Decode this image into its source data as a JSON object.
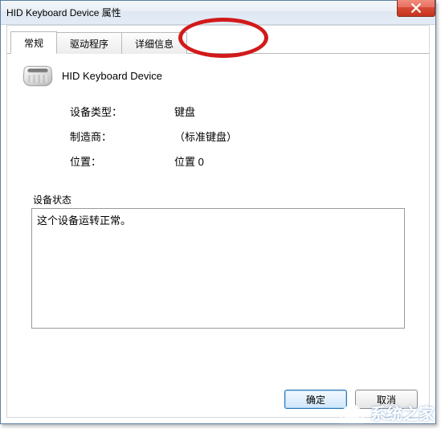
{
  "window": {
    "title": "HID Keyboard Device 属性"
  },
  "tabs": {
    "general": "常规",
    "driver": "驱动程序",
    "details": "详细信息"
  },
  "device": {
    "name": "HID Keyboard Device"
  },
  "props": {
    "type_label": "设备类型：",
    "type_value": "键盘",
    "mfr_label": "制造商：",
    "mfr_value": "（标准键盘）",
    "loc_label": "位置：",
    "loc_value": "位置 0"
  },
  "status": {
    "label": "设备状态",
    "text": "这个设备运转正常。"
  },
  "buttons": {
    "ok": "确定",
    "cancel": "取消"
  },
  "watermark": {
    "text": "系统之家"
  }
}
